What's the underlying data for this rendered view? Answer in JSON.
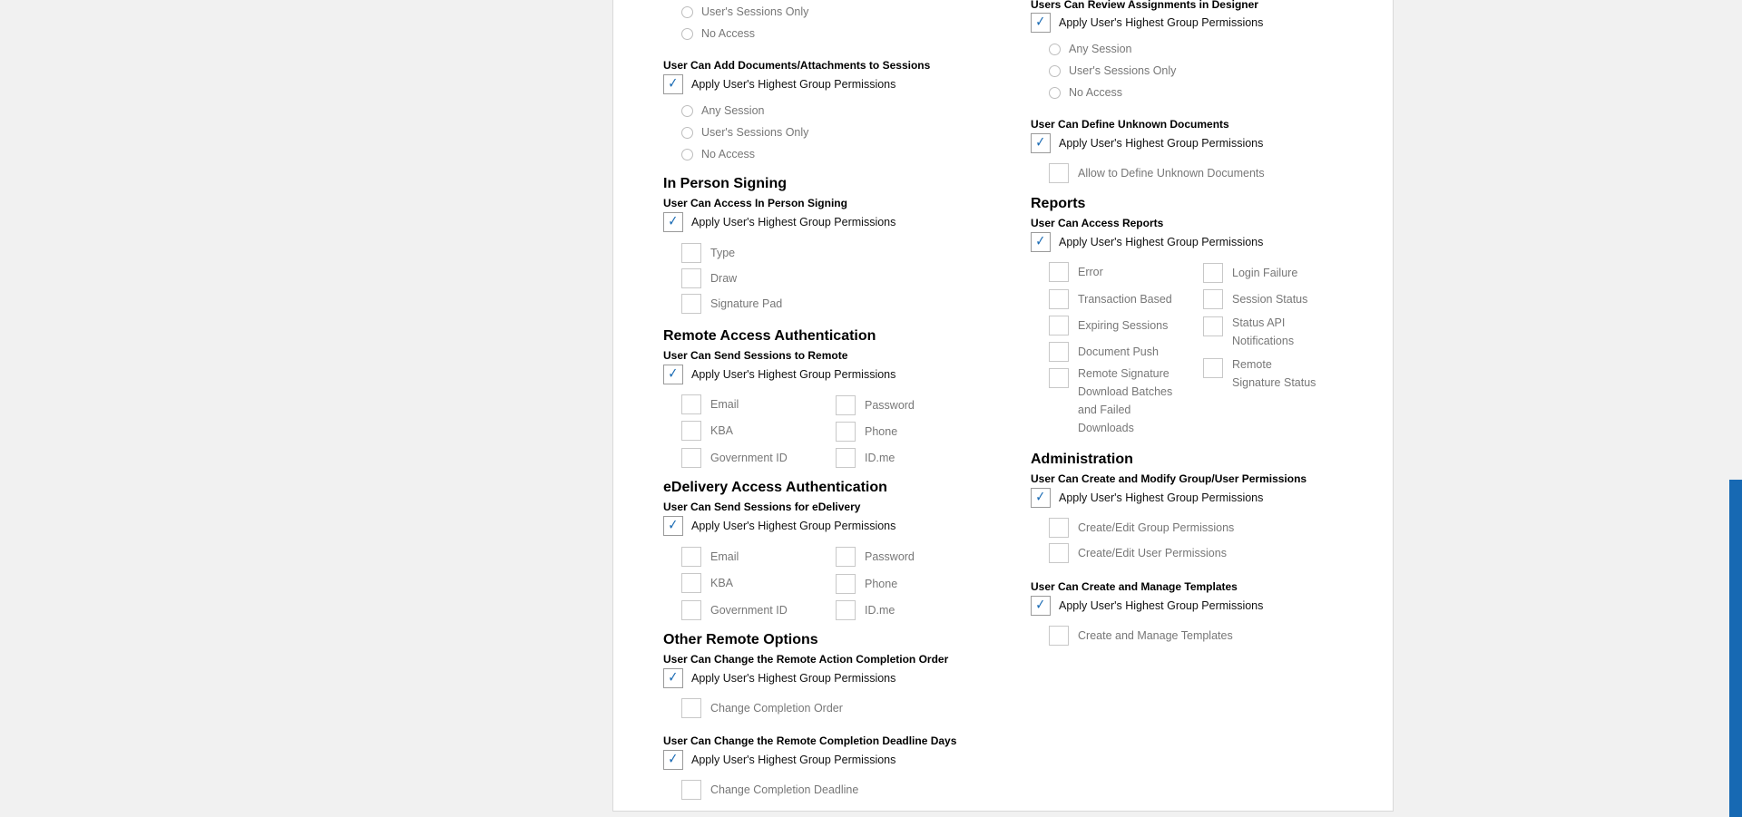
{
  "apply_label": "Apply User's Highest Group Permissions",
  "check_glyph": "✓",
  "radio_options": [
    "Any Session",
    "User's Sessions Only",
    "No Access"
  ],
  "left": {
    "top_radios": [
      "User's Sessions Only",
      "No Access"
    ],
    "add_docs": {
      "title": "User Can Add Documents/Attachments to Sessions"
    },
    "in_person": {
      "heading": "In Person Signing",
      "title": "User Can Access In Person Signing",
      "options": [
        "Type",
        "Draw",
        "Signature Pad"
      ]
    },
    "remote_auth": {
      "heading": "Remote Access Authentication",
      "title": "User Can Send Sessions to Remote",
      "options_left": [
        "Email",
        "KBA",
        "Government ID"
      ],
      "options_right": [
        "Password",
        "Phone",
        "ID.me"
      ]
    },
    "edelivery_auth": {
      "heading": "eDelivery Access Authentication",
      "title": "User Can Send Sessions for eDelivery",
      "options_left": [
        "Email",
        "KBA",
        "Government ID"
      ],
      "options_right": [
        "Password",
        "Phone",
        "ID.me"
      ]
    },
    "other_remote": {
      "heading": "Other Remote Options",
      "completion_order_title": "User Can Change the Remote Action Completion Order",
      "completion_order_option": "Change Completion Order",
      "deadline_title": "User Can Change the Remote Completion Deadline Days",
      "deadline_option": "Change Completion Deadline"
    }
  },
  "right": {
    "review": {
      "title": "Users Can Review Assignments in Designer"
    },
    "unknown_docs": {
      "title": "User Can Define Unknown Documents",
      "option": "Allow to Define Unknown Documents"
    },
    "reports": {
      "heading": "Reports",
      "title": "User Can Access Reports",
      "options_left": [
        "Error",
        "Transaction Based",
        "Expiring Sessions",
        "Document Push",
        "Remote Signature Download Batches and Failed Downloads"
      ],
      "options_right": [
        "Login Failure",
        "Session Status",
        "Status API Notifications",
        "Remote Signature Status"
      ]
    },
    "administration": {
      "heading": "Administration",
      "title": "User Can Create and Modify Group/User Permissions",
      "options": [
        "Create/Edit Group Permissions",
        "Create/Edit User Permissions"
      ]
    },
    "templates": {
      "title": "User Can Create and Manage Templates",
      "option": "Create and Manage Templates"
    }
  }
}
